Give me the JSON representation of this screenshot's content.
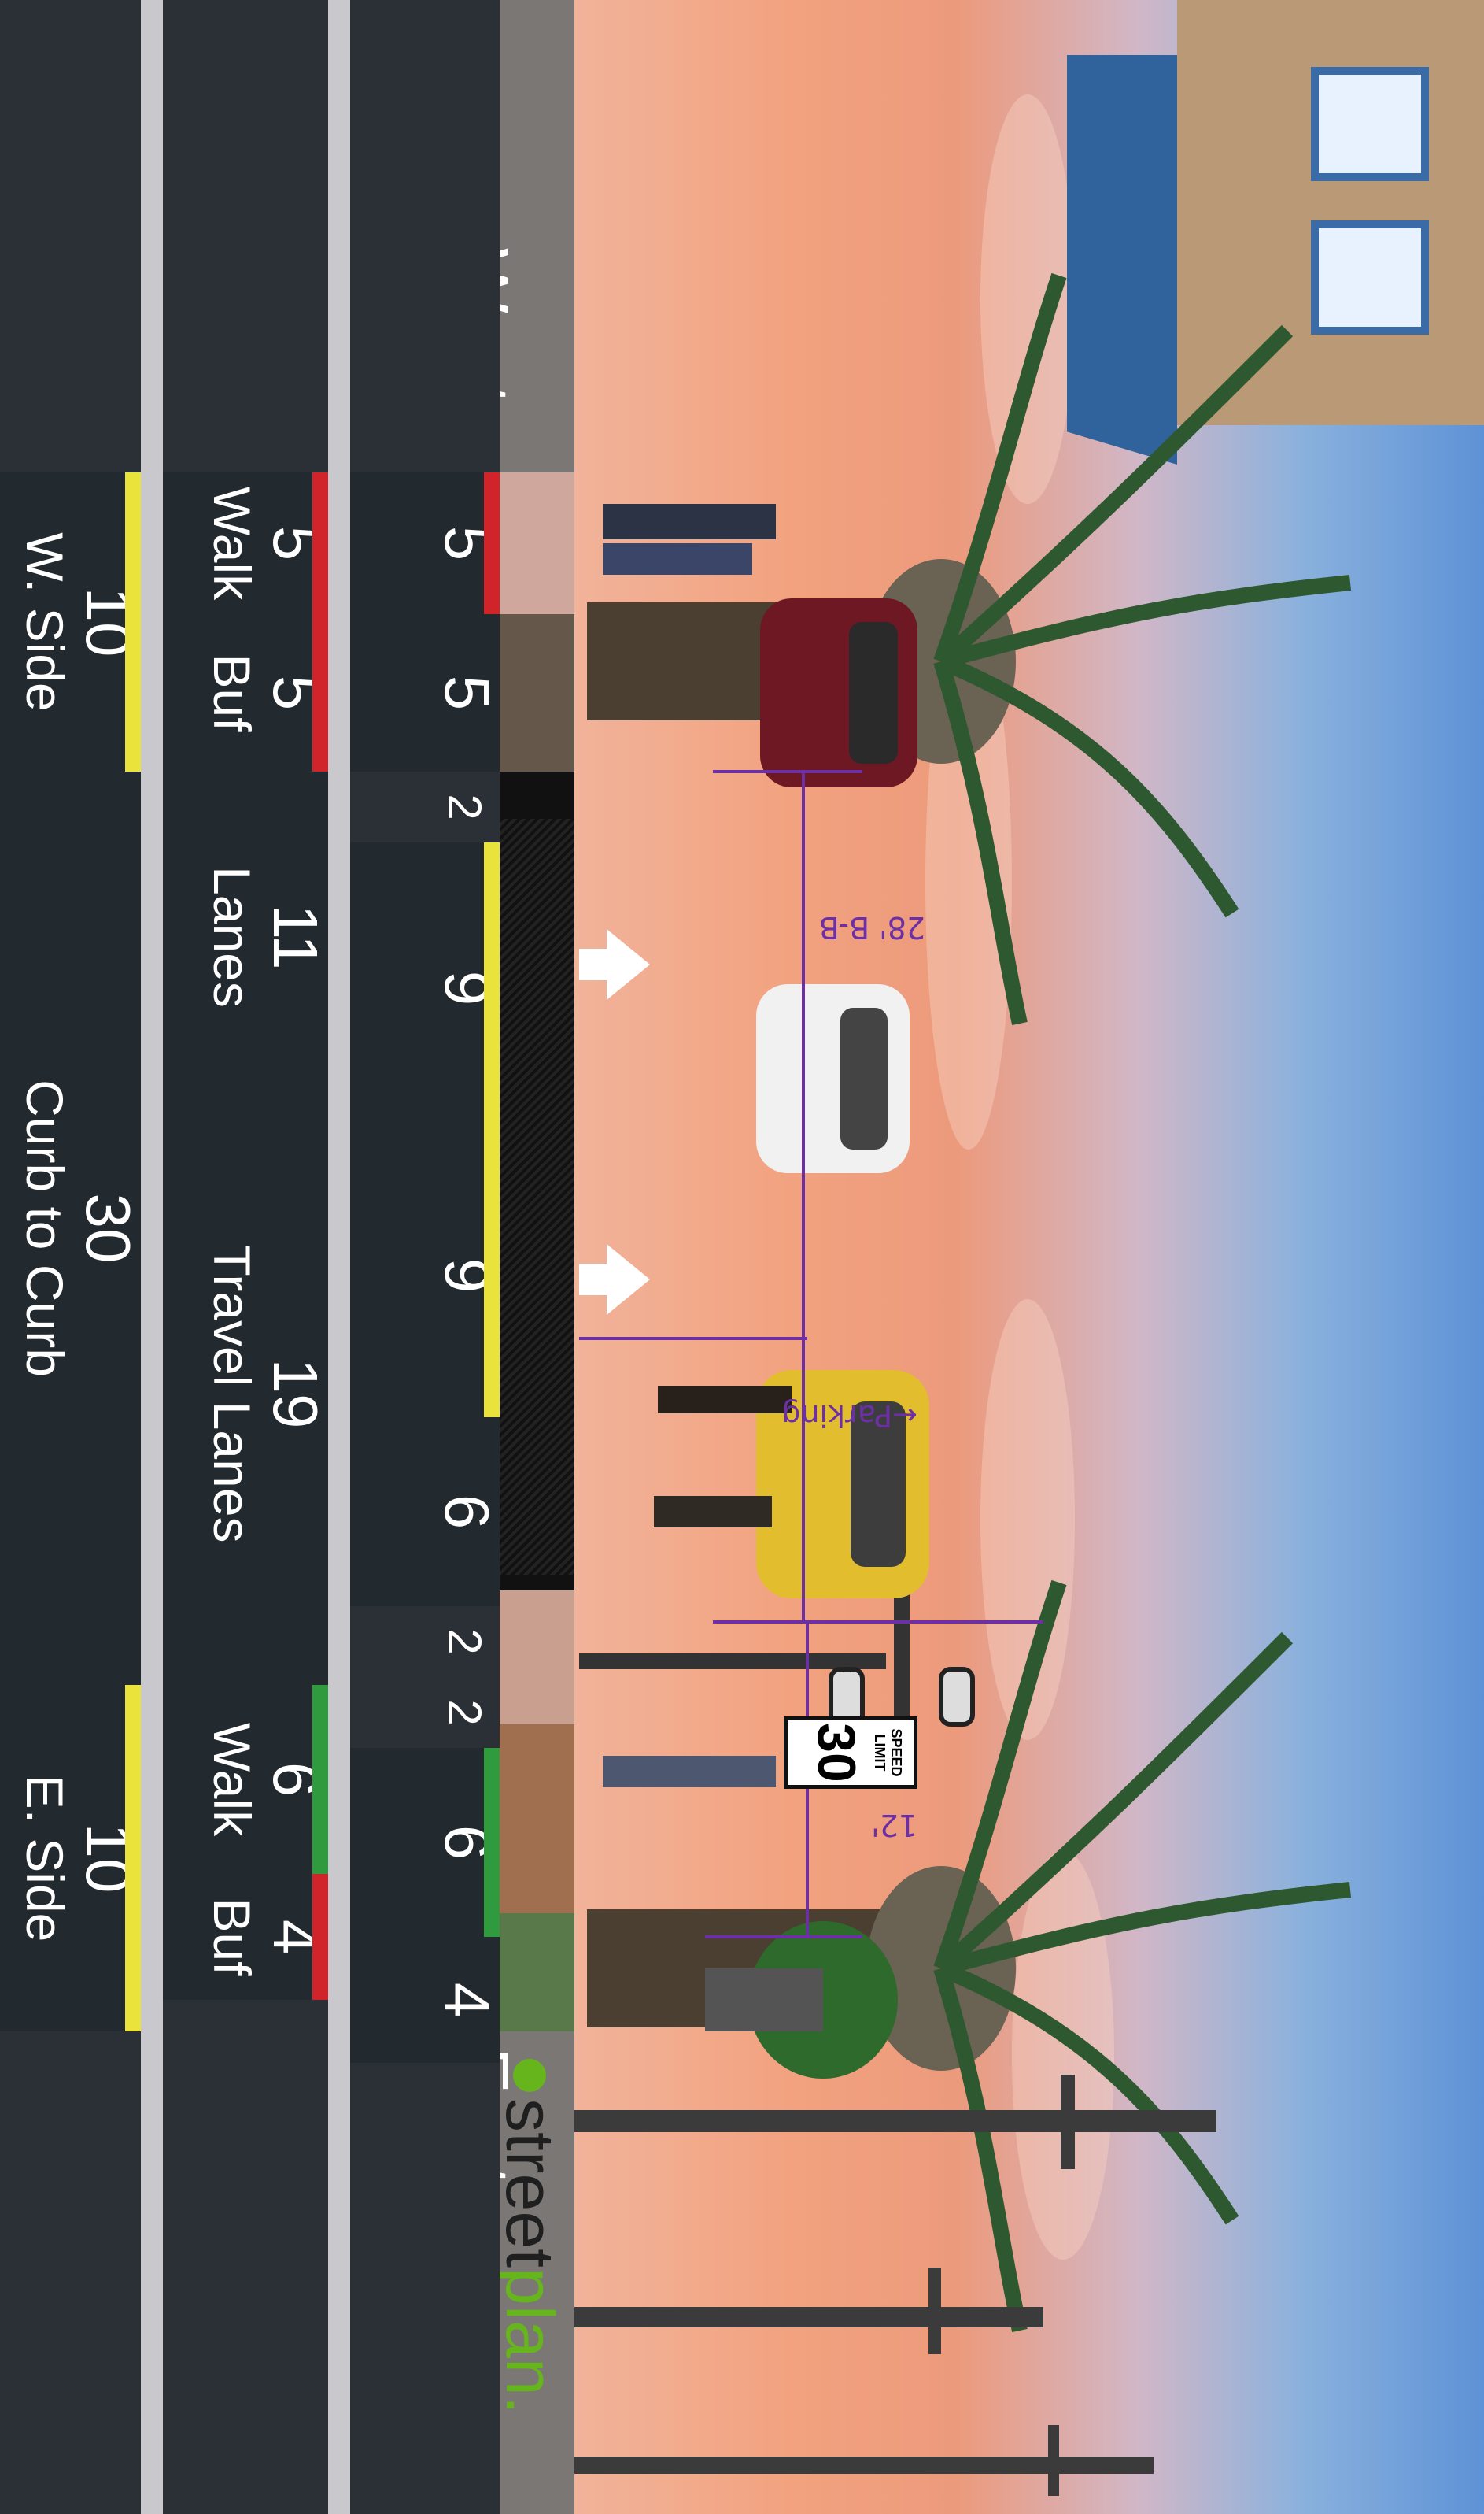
{
  "directions": {
    "west": "West",
    "east": "East"
  },
  "annotations": {
    "width_bb": "28' B-B",
    "parking": "←Parking",
    "width_east": "12'"
  },
  "brand": {
    "street": "street",
    "plan": "plan",
    "dot": "."
  },
  "speed_sign": {
    "line1": "SPEED",
    "line2": "LIMIT",
    "value": "30"
  },
  "cross_section": {
    "row1": [
      {
        "value": "5"
      },
      {
        "value": "5"
      },
      {
        "value": "2"
      },
      {
        "value": "9"
      },
      {
        "value": "9"
      },
      {
        "value": "6"
      },
      {
        "value": "2"
      },
      {
        "value": "2"
      },
      {
        "value": "6"
      },
      {
        "value": "4"
      }
    ],
    "row2": [
      {
        "value": "5",
        "label": "Walk"
      },
      {
        "value": "5",
        "label": "Buf"
      },
      {
        "value": "11",
        "label": "Lanes"
      },
      {
        "value": "19",
        "label": "Travel Lanes"
      },
      {
        "value": "6",
        "label": "Walk"
      },
      {
        "value": "4",
        "label": "Buf"
      }
    ],
    "row3": [
      {
        "value": "10",
        "label": "W. Side"
      },
      {
        "value": "30",
        "label": "Curb to Curb"
      },
      {
        "value": "10",
        "label": "E. Side"
      }
    ]
  },
  "colors": {
    "red": "#d1232a",
    "yellow": "#e9e33c",
    "green": "#2f9b3e",
    "gray": "#c8c8cd",
    "brand_green": "#67b51d",
    "annotation": "#6d2fa5"
  }
}
